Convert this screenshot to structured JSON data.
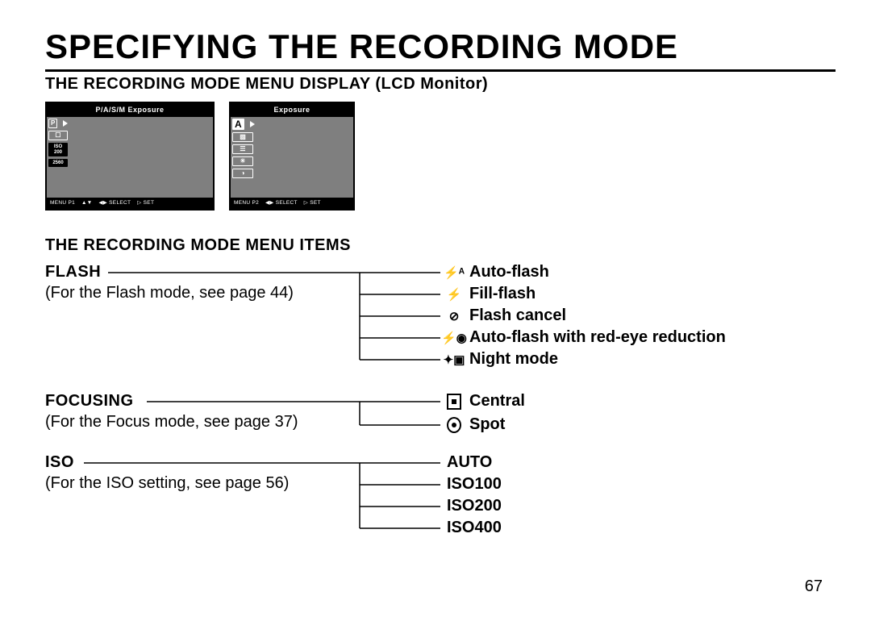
{
  "title": "SPECIFYING THE RECORDING MODE",
  "section_display": "THE RECORDING MODE MENU DISPLAY (LCD Monitor)",
  "section_items": "THE RECORDING MODE MENU ITEMS",
  "page_number": "67",
  "lcd1": {
    "top": "P/A/S/M Exposure",
    "side": [
      "P",
      "☐",
      "ISO\n200",
      "2560"
    ],
    "bottom": [
      "MENU P1",
      "▲▼",
      "◀▶ SELECT",
      "▷ SET"
    ]
  },
  "lcd2": {
    "top": "Exposure",
    "side": [
      "A",
      "▨",
      "☰",
      "☀",
      "◑"
    ],
    "bottom": [
      "MENU P2",
      "◀▶ SELECT",
      "▷ SET"
    ]
  },
  "flash": {
    "header": "FLASH",
    "note": "(For the Flash mode, see page 44)",
    "options": [
      {
        "icon": "⚡ᴬ",
        "label": "Auto-flash"
      },
      {
        "icon": "⚡",
        "label": "Fill-flash"
      },
      {
        "icon": "⊘",
        "label": "Flash cancel"
      },
      {
        "icon": "⚡◉",
        "label": "Auto-flash with red-eye reduction"
      },
      {
        "icon": "✦▣",
        "label": "Night mode"
      }
    ]
  },
  "focusing": {
    "header": "FOCUSING",
    "note": "(For the Focus mode, see page 37)",
    "options": [
      {
        "label": "Central"
      },
      {
        "label": "Spot"
      }
    ]
  },
  "iso": {
    "header": "ISO",
    "note": "(For the ISO setting, see page 56)",
    "options": [
      {
        "label": "AUTO"
      },
      {
        "label": "ISO100"
      },
      {
        "label": "ISO200"
      },
      {
        "label": "ISO400"
      }
    ]
  }
}
